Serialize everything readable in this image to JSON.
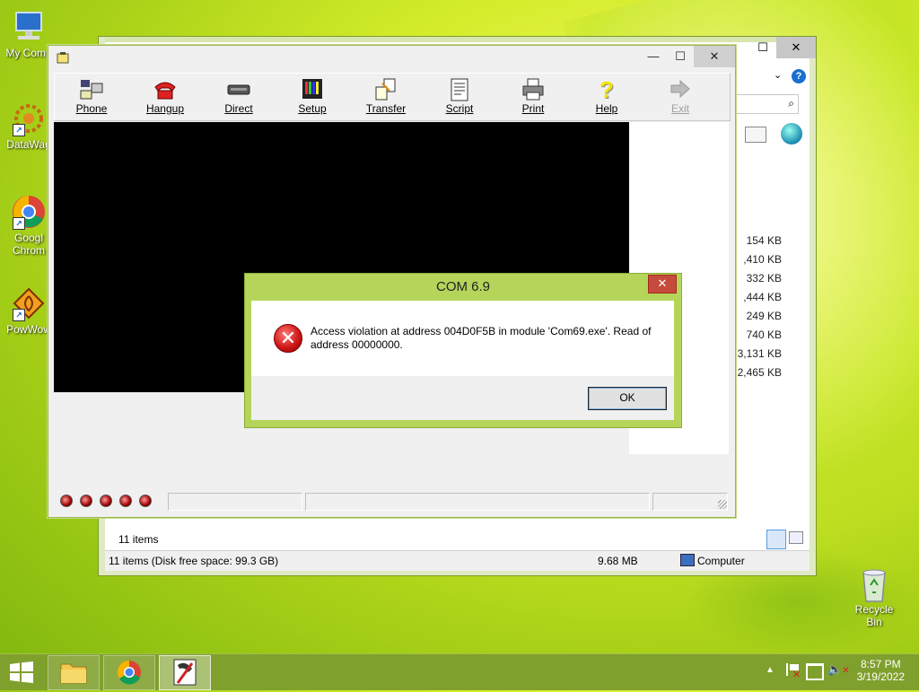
{
  "desktop": {
    "icons": [
      {
        "label": "My Comp",
        "icon": "computer-icon"
      },
      {
        "label": "DataWag",
        "icon": "datawag-icon"
      },
      {
        "label": "Googl Chrom",
        "icon": "chrome-icon"
      },
      {
        "label": "PowWow",
        "icon": "powwow-icon"
      },
      {
        "label": "Recycle Bin",
        "icon": "recycle-bin-icon"
      }
    ]
  },
  "explorer": {
    "sizes": [
      "154 KB",
      ",410 KB",
      "332 KB",
      ",444 KB",
      "249 KB",
      "740 KB",
      "3,131 KB",
      "2,465 KB"
    ],
    "items_count": "11 items",
    "status_left": "11 items (Disk free space: 99.3 GB)",
    "status_size": "9.68 MB",
    "status_location": "Computer"
  },
  "com_window": {
    "toolbar": [
      {
        "label": "Phone",
        "icon": "phone-icon",
        "enabled": true
      },
      {
        "label": "Hangup",
        "icon": "hangup-icon",
        "enabled": true
      },
      {
        "label": "Direct",
        "icon": "direct-connect-icon",
        "enabled": true
      },
      {
        "label": "Setup",
        "icon": "setup-icon",
        "enabled": true
      },
      {
        "label": "Transfer",
        "icon": "transfer-icon",
        "enabled": true
      },
      {
        "label": "Script",
        "icon": "script-icon",
        "enabled": true
      },
      {
        "label": "Print",
        "icon": "printer-icon",
        "enabled": true
      },
      {
        "label": "Help",
        "icon": "help-icon",
        "enabled": true
      },
      {
        "label": "Exit",
        "icon": "exit-icon",
        "enabled": false
      }
    ]
  },
  "dialog": {
    "title": "COM 6.9",
    "close_glyph": "✕",
    "message": "Access violation at address 004D0F5B in module 'Com69.exe'. Read of address 00000000.",
    "ok_label": "OK"
  },
  "taskbar": {
    "time": "8:57 PM",
    "date": "3/19/2022"
  },
  "colors": {
    "dialog_frame": "#b5d55a",
    "taskbar": "#7fa02c",
    "error_red": "#d01818"
  }
}
